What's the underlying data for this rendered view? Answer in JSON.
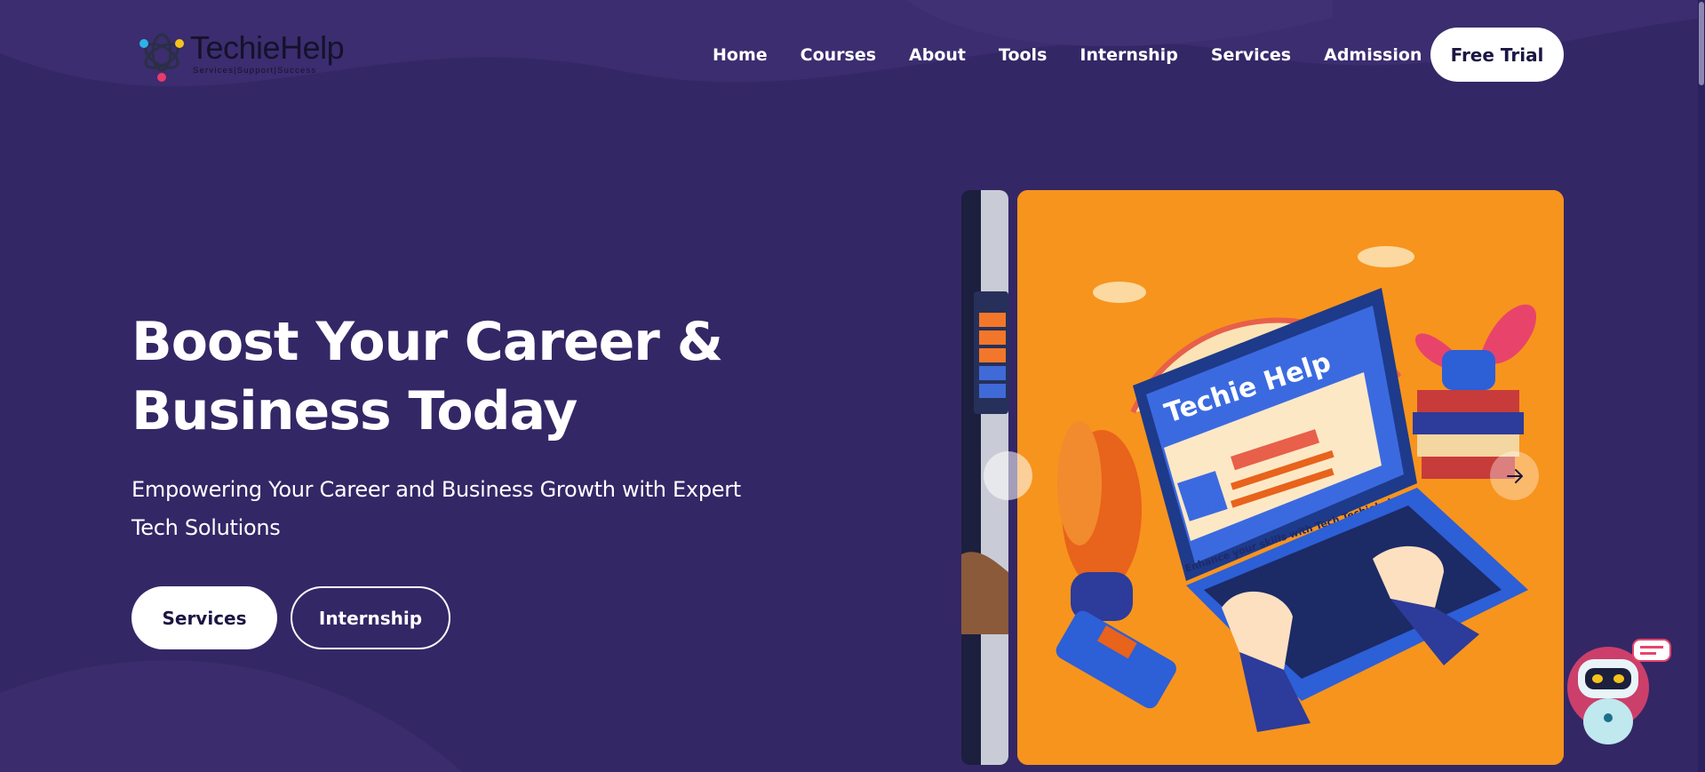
{
  "brand": {
    "name": "TechieHelp",
    "tagline": "Services|Support|Success"
  },
  "nav": {
    "items": [
      "Home",
      "Courses",
      "About",
      "Tools",
      "Internship",
      "Services",
      "Admission"
    ],
    "cta_label": "Free Trial"
  },
  "hero": {
    "title_line1": "Boost Your Career &",
    "title_line2": "Business Today",
    "subtitle_line1": "Empowering Your Career and Business Growth with Expert",
    "subtitle_line2": "Tech Solutions",
    "primary_button": "Services",
    "secondary_button": "Internship"
  },
  "slider": {
    "image_title": "Techie Help",
    "image_caption": "Enhance your skills with Tech Techiehelp",
    "prev_icon": "chevron-left-icon",
    "next_icon": "arrow-right-icon"
  },
  "colors": {
    "background": "#342766",
    "slide_background": "#f7941d",
    "button_text": "#1b1642"
  }
}
